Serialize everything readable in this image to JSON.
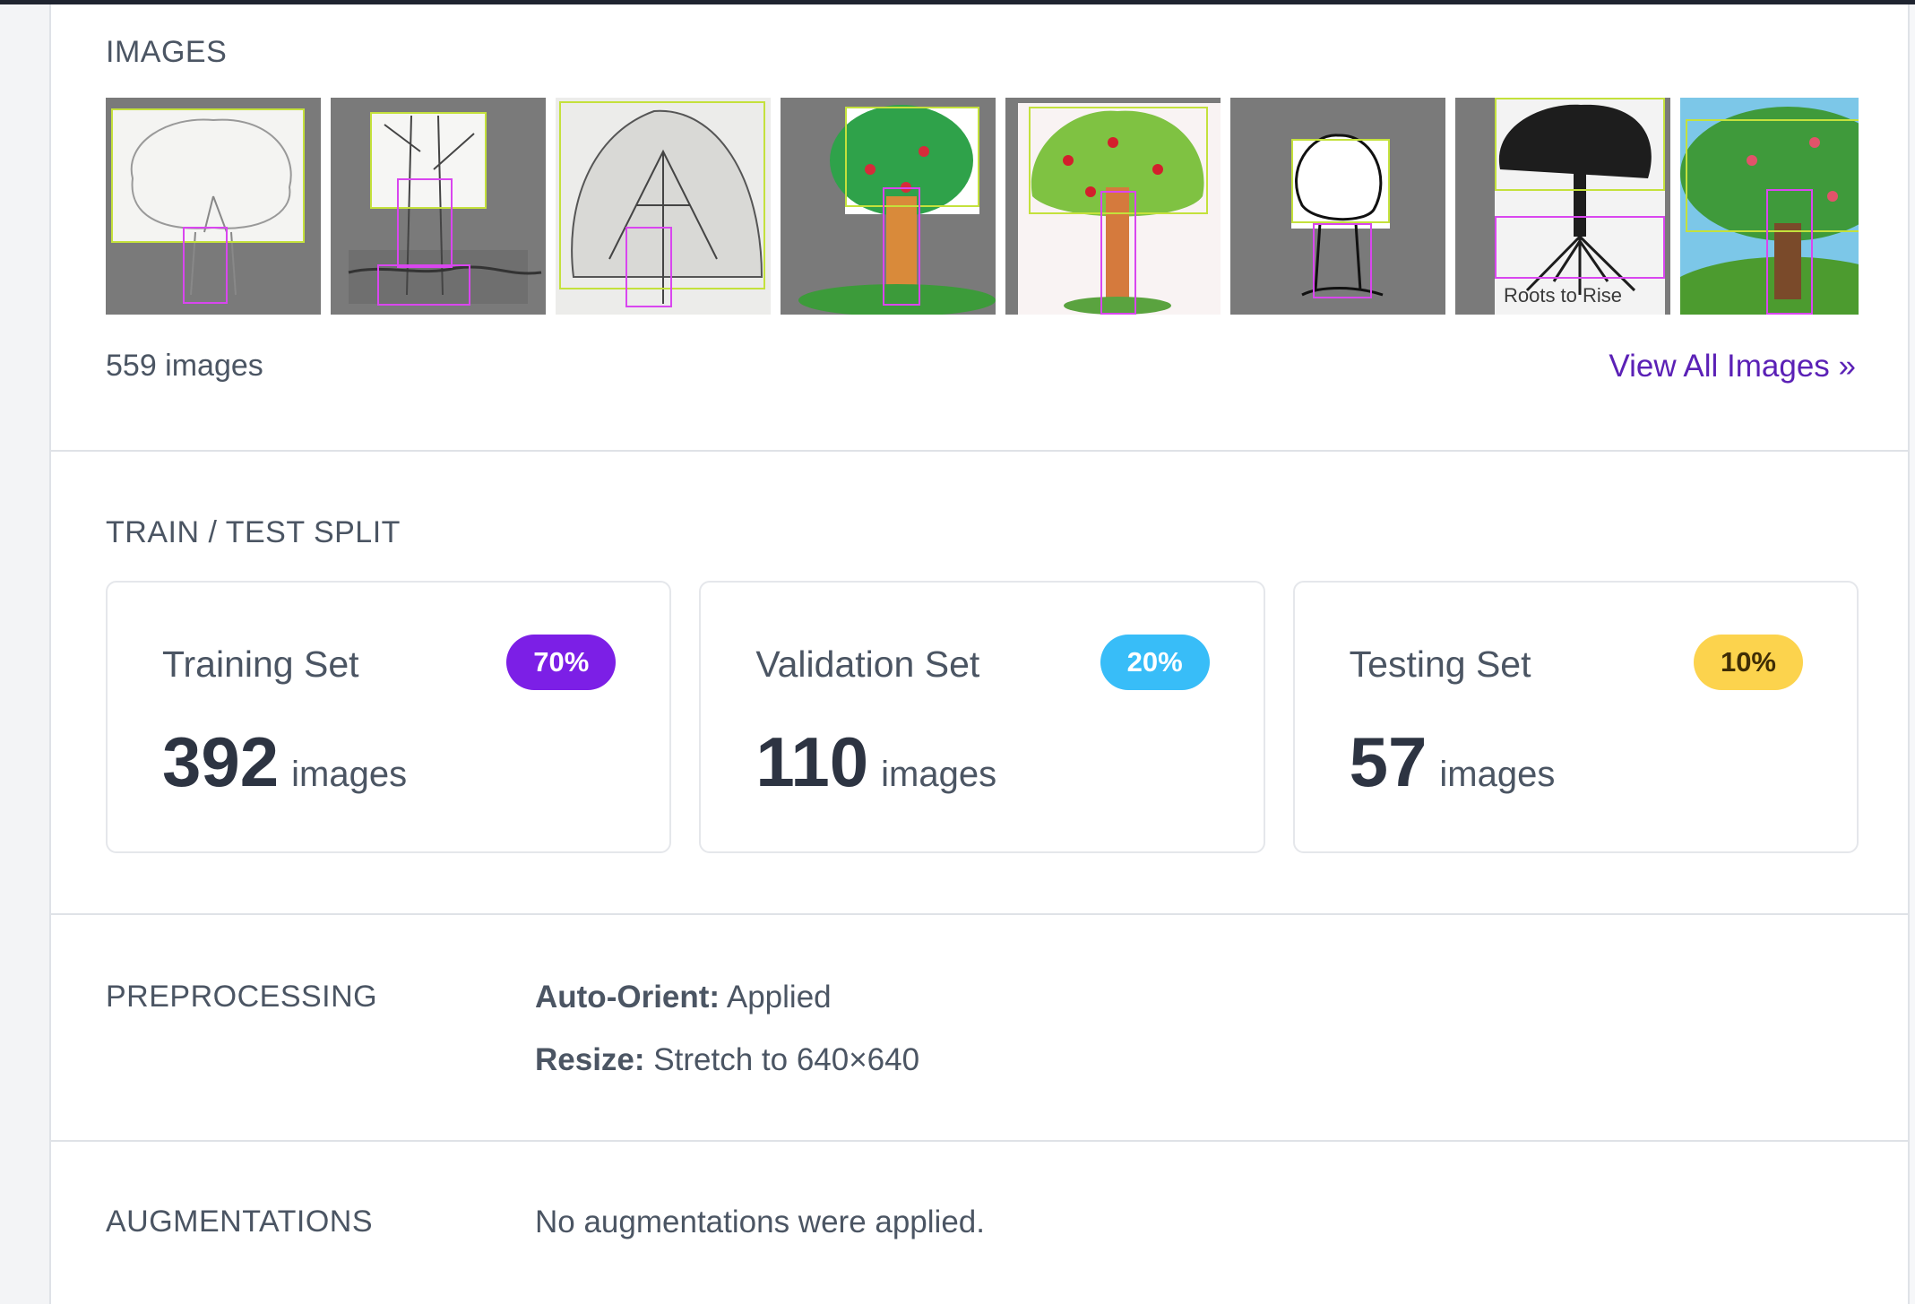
{
  "images_section": {
    "title": "IMAGES",
    "count_label": "559 images",
    "view_all_label": "View All Images »",
    "thumb_caption_7": "Roots to Rise"
  },
  "split_section": {
    "title": "TRAIN / TEST SPLIT",
    "cards": [
      {
        "label": "Training Set",
        "percent": "70%",
        "count": "392",
        "unit": "images",
        "badge_bg": "#7c1fe6",
        "badge_fg": "#ffffff"
      },
      {
        "label": "Validation Set",
        "percent": "20%",
        "count": "110",
        "unit": "images",
        "badge_bg": "#38bdf8",
        "badge_fg": "#ffffff"
      },
      {
        "label": "Testing Set",
        "percent": "10%",
        "count": "57",
        "unit": "images",
        "badge_bg": "#fcd34d",
        "badge_fg": "#3f2d05"
      }
    ]
  },
  "preprocessing": {
    "title": "PREPROCESSING",
    "items": [
      {
        "key": "Auto-Orient:",
        "value": "Applied"
      },
      {
        "key": "Resize:",
        "value": "Stretch to 640×640"
      }
    ]
  },
  "augmentations": {
    "title": "AUGMENTATIONS",
    "text": "No augmentations were applied."
  }
}
